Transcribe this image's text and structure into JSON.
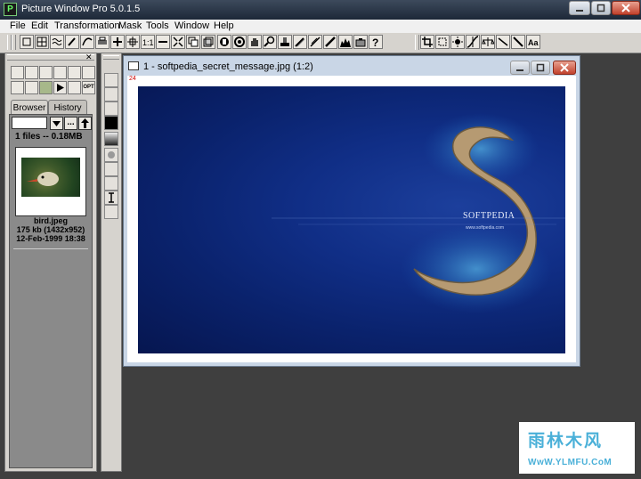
{
  "window": {
    "title": "Picture Window Pro 5.0.1.5",
    "app_icon": "P"
  },
  "menu": {
    "items": [
      "File",
      "Edit",
      "Transformation",
      "Mask",
      "Tools",
      "Window",
      "Help"
    ]
  },
  "left_panel": {
    "tabs": [
      "Browser",
      "History"
    ],
    "active_tab": "Browser",
    "nav_more": "...",
    "files_count": "1 files -- 0.18MB",
    "thumbnail": {
      "name": "bird.jpeg",
      "size": "175 kb (1432x952)",
      "date": "12-Feb-1999 18:38"
    },
    "opt_label": "OPT"
  },
  "document": {
    "title": "1 - softpedia_secret_message.jpg (1:2)",
    "zoom_note": "24",
    "image_text": "SOFTPEDIA",
    "image_url": "www.softpedia.com"
  },
  "watermark": {
    "brand": "雨林木风",
    "url": "WwW.YLMFU.CoM"
  },
  "colors": {
    "titlebar": "#1d2838",
    "workspace": "#3f3f3f",
    "image_blue": "#102e86"
  }
}
